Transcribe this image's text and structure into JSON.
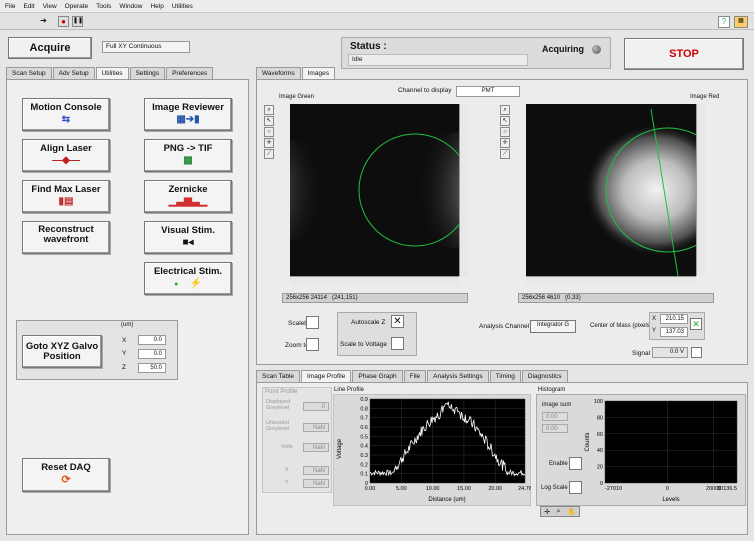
{
  "menu": [
    "File",
    "Edit",
    "View",
    "Operate",
    "Tools",
    "Window",
    "Help",
    "Utilities"
  ],
  "acquire_label": "Acquire",
  "mode_value": "Full XY Continuous",
  "status": {
    "label": "Status :",
    "value": "Idle",
    "acquiring_label": "Acquiring"
  },
  "stop_label": "STOP",
  "left_tabs": [
    "Scan Setup",
    "Adv Setup",
    "Utilities",
    "Settings",
    "Preferences"
  ],
  "utilities": {
    "motion_console": "Motion Console",
    "image_reviewer": "Image Reviewer",
    "align_laser": "Align Laser",
    "png_tif": "PNG -> TIF",
    "find_max_laser": "Find Max Laser",
    "zernicke": "Zernicke",
    "reconstruct": "Reconstruct wavefront",
    "visual_stim": "Visual Stim.",
    "electrical_stim": "Electrical Stim.",
    "goto_xyz": "Goto XYZ Galvo Position",
    "units": "(um)",
    "x_label": "X",
    "y_label": "Y",
    "z_label": "Z",
    "x_value": "0.0",
    "y_value": "0.0",
    "z_value": "50.0",
    "reset_daq": "Reset DAQ"
  },
  "right_tabs": [
    "Waveforms",
    "Images"
  ],
  "images": {
    "channel_label": "Channel to display",
    "channel_value": "PMT",
    "green_title": "Image Green",
    "red_title": "Image Red",
    "green_status_a": "256x256 24114",
    "green_status_b": "(241,151)",
    "red_status_a": "256x256 4610",
    "red_status_b": "(0,33)",
    "scalebar": "Scalebar",
    "zoom_to_fit": "Zoom to fit",
    "autoscale_z": "Autoscale Z",
    "scale_to_voltage": "Scale to Voltage",
    "analysis_channel_label": "Analysis Channel",
    "analysis_channel_value": "Integrator G",
    "com_label": "Center of Mass (pixels)",
    "com_x_label": "X",
    "com_x": "210.15",
    "com_y_label": "Y",
    "com_y": "137.03",
    "signal_label": "Signal",
    "signal_value": "0.0 V"
  },
  "bottom_tabs": [
    "Scan Table",
    "Image Profile",
    "Phase Graph",
    "File",
    "Analysis Settings",
    "Timing",
    "Diagnostics"
  ],
  "profile": {
    "point_profile": "Point Profile",
    "displayed_greylevel": "Displayed Greylevel",
    "displayed_value": "0",
    "unscaled_greylevel": "Unscaled Greylevel",
    "unscaled_value": "NaN",
    "volts_label": "Volts",
    "volts_value": "NaN",
    "px_label": "X",
    "px_value": "NaN",
    "py_label": "Y",
    "py_value": "NaN",
    "line_title": "Line Profile",
    "ylabel": "Voltage",
    "xlabel": "Distance (um)",
    "yticks": [
      "0.9",
      "0.8",
      "0.7",
      "0.6",
      "0.5",
      "0.4",
      "0.3",
      "0.2",
      "0.1",
      "0"
    ],
    "xticks": [
      "0.00",
      "5.00",
      "10.00",
      "15.00",
      "20.00",
      "24.76"
    ],
    "histogram_title": "Histogram",
    "image_sum": "image sum",
    "sum_a": "0.00",
    "sum_b": "0.00",
    "enable_label": "Enable",
    "log_scale_label": "Log Scale",
    "h_ylabel": "Counts",
    "h_xlabel": "Levels",
    "h_yticks": [
      "100",
      "80",
      "60",
      "40",
      "20",
      "0"
    ],
    "h_xticks": [
      "-27010",
      "0",
      "20000",
      "30136.5"
    ]
  },
  "colors": {
    "stop_text": "#cc0000",
    "circle": "#20c040",
    "plot_line": "#ffffff",
    "plot_bg": "#000000"
  }
}
